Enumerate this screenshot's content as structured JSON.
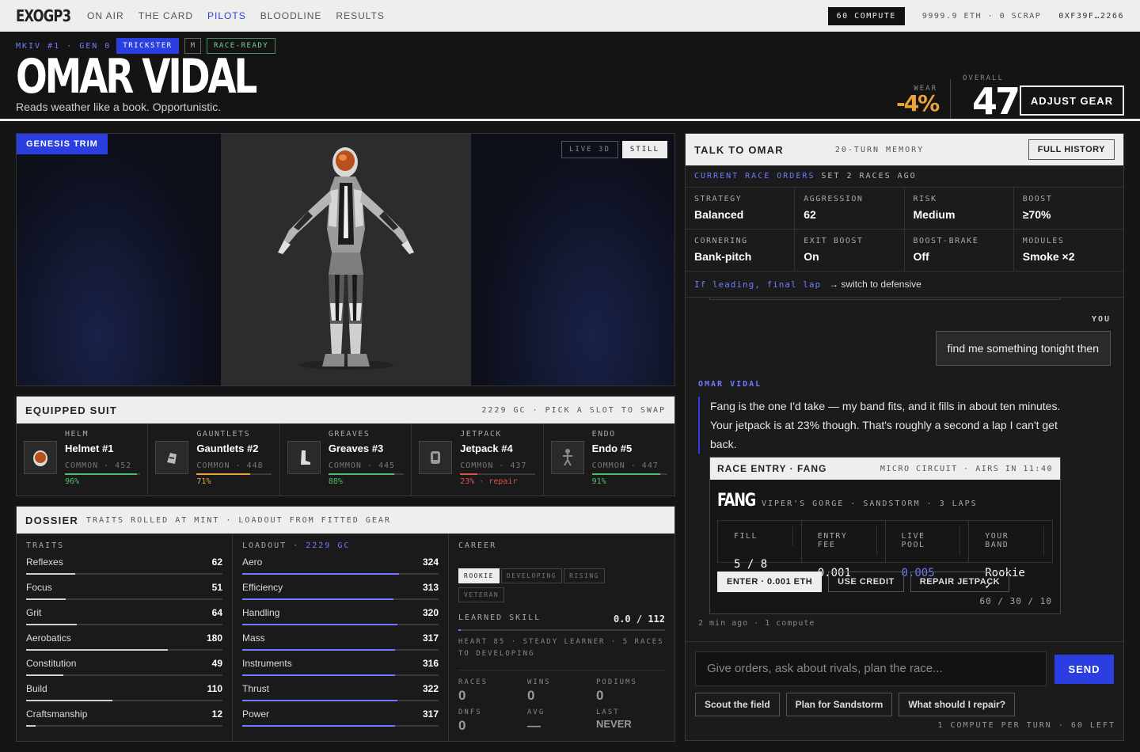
{
  "nav": {
    "logo": "EXOGP3",
    "links": [
      "ON AIR",
      "THE CARD",
      "PILOTS",
      "BLOODLINE",
      "RESULTS"
    ],
    "compute": "60 COMPUTE",
    "balance": "9999.9 ETH · 0 SCRAP",
    "wallet": "0XF39F…2266"
  },
  "hero": {
    "id_line": "MKIV #1 · GEN 0",
    "class_tag": "TRICKSTER",
    "gender_tag": "M",
    "status_tag": "RACE-READY",
    "name": "OMAR VIDAL",
    "tagline": "Reads weather like a book. Opportunistic.",
    "wear_label": "WEAR",
    "wear_value": "-4%",
    "overall_label": "OVERALL",
    "overall_value": "47",
    "adjust_label": "ADJUST GEAR"
  },
  "viewer": {
    "trim_label": "GENESIS TRIM",
    "live_label": "LIVE 3D",
    "still_label": "STILL"
  },
  "suit": {
    "title": "EQUIPPED SUIT",
    "subtitle": "2229 GC · PICK A SLOT TO SWAP",
    "slots": [
      {
        "slot": "HELM",
        "name": "Helmet #1",
        "rarity": "COMMON · 452",
        "pct": "96%",
        "fill": 0.96,
        "color": "#4fc06a",
        "icon": "helmet-icon"
      },
      {
        "slot": "GAUNTLETS",
        "name": "Gauntlets #2",
        "rarity": "COMMON · 448",
        "pct": "71%",
        "fill": 0.71,
        "color": "#e8a43a",
        "icon": "gauntlet-icon"
      },
      {
        "slot": "GREAVES",
        "name": "Greaves #3",
        "rarity": "COMMON · 445",
        "pct": "88%",
        "fill": 0.88,
        "color": "#4fc06a",
        "icon": "boot-icon"
      },
      {
        "slot": "JETPACK",
        "name": "Jetpack #4",
        "rarity": "COMMON · 437",
        "pct": "23% · repair",
        "fill": 0.23,
        "color": "#e0524a",
        "icon": "jetpack-icon"
      },
      {
        "slot": "ENDO",
        "name": "Endo #5",
        "rarity": "COMMON · 447",
        "pct": "91%",
        "fill": 0.91,
        "color": "#4fc06a",
        "icon": "endo-icon"
      }
    ]
  },
  "dossier": {
    "title": "DOSSIER",
    "subtitle": "TRAITS ROLLED AT MINT · LOADOUT FROM FITTED GEAR",
    "traits_label": "TRAITS",
    "traits": [
      {
        "name": "Reflexes",
        "value": "62",
        "fill": 0.25
      },
      {
        "name": "Focus",
        "value": "51",
        "fill": 0.2
      },
      {
        "name": "Grit",
        "value": "64",
        "fill": 0.26
      },
      {
        "name": "Aerobatics",
        "value": "180",
        "fill": 0.72
      },
      {
        "name": "Constitution",
        "value": "49",
        "fill": 0.19
      },
      {
        "name": "Build",
        "value": "110",
        "fill": 0.44
      },
      {
        "name": "Craftsmanship",
        "value": "12",
        "fill": 0.05
      }
    ],
    "loadout_label": "LOADOUT ·",
    "loadout_value": "2229 GC",
    "loadout": [
      {
        "name": "Aero",
        "value": "324",
        "fill": 0.8
      },
      {
        "name": "Efficiency",
        "value": "313",
        "fill": 0.77
      },
      {
        "name": "Handling",
        "value": "320",
        "fill": 0.79
      },
      {
        "name": "Mass",
        "value": "317",
        "fill": 0.78
      },
      {
        "name": "Instruments",
        "value": "316",
        "fill": 0.78
      },
      {
        "name": "Thrust",
        "value": "322",
        "fill": 0.79
      },
      {
        "name": "Power",
        "value": "317",
        "fill": 0.78
      }
    ],
    "career_label": "CAREER",
    "stages": [
      "ROOKIE",
      "DEVELOPING",
      "RISING",
      "VETERAN"
    ],
    "skill_label": "LEARNED SKILL",
    "skill_value": "0.0 / 112",
    "skill_note": "HEART 85 · STEADY LEARNER · 5 RACES TO DEVELOPING",
    "career_stats": [
      {
        "k": "RACES",
        "v": "0"
      },
      {
        "k": "WINS",
        "v": "0"
      },
      {
        "k": "PODIUMS",
        "v": "0"
      },
      {
        "k": "DNFS",
        "v": "0"
      },
      {
        "k": "AVG",
        "v": "—"
      },
      {
        "k": "LAST",
        "v": "NEVER"
      }
    ]
  },
  "chat": {
    "title": "TALK TO OMAR",
    "memory": "20-TURN MEMORY",
    "history_label": "FULL HISTORY",
    "orders_label": "CURRENT RACE ORDERS",
    "orders_when": "SET 2 RACES AGO",
    "orders": [
      {
        "k": "STRATEGY",
        "v": "Balanced"
      },
      {
        "k": "AGGRESSION",
        "v": "62"
      },
      {
        "k": "RISK",
        "v": "Medium"
      },
      {
        "k": "BOOST",
        "v": "≥70%"
      },
      {
        "k": "CORNERING",
        "v": "Bank-pitch"
      },
      {
        "k": "EXIT BOOST",
        "v": "On"
      },
      {
        "k": "BOOST-BRAKE",
        "v": "Off"
      },
      {
        "k": "MODULES",
        "v": "Smoke ×2"
      }
    ],
    "condition": "If leading, final lap",
    "condition_action": "→ switch to defensive",
    "you_label": "YOU",
    "you_message": "find me something tonight then",
    "pilot_label": "OMAR VIDAL",
    "pilot_message": "Fang is the one I'd take — my band fits, and it fills in about ten minutes. Your jetpack is at 23% though. That's roughly a second a lap I can't get back.",
    "race_card": {
      "title": "RACE ENTRY · FANG",
      "meta": "MICRO CIRCUIT · AIRS IN 11:40",
      "name": "FANG",
      "venue": "VIPER'S GORGE · SANDSTORM · 3 LAPS",
      "stats": [
        {
          "k": "FILL",
          "v": "5 / 8"
        },
        {
          "k": "ENTRY FEE",
          "v": "0.001"
        },
        {
          "k": "LIVE POOL",
          "v": "0.005"
        },
        {
          "k": "YOUR BAND",
          "v": "Rookie ✓"
        }
      ],
      "enter_label": "ENTER · 0.001 ETH",
      "credit_label": "USE CREDIT",
      "repair_label": "REPAIR JETPACK",
      "split": "60 / 30 / 10"
    },
    "msg_meta": "2 min ago · 1 compute",
    "input_placeholder": "Give orders, ask about rivals, plan the race...",
    "send_label": "SEND",
    "suggestions": [
      "Scout the field",
      "Plan for Sandstorm",
      "What should I repair?"
    ],
    "footer": "1 COMPUTE PER TURN · 60 LEFT"
  }
}
